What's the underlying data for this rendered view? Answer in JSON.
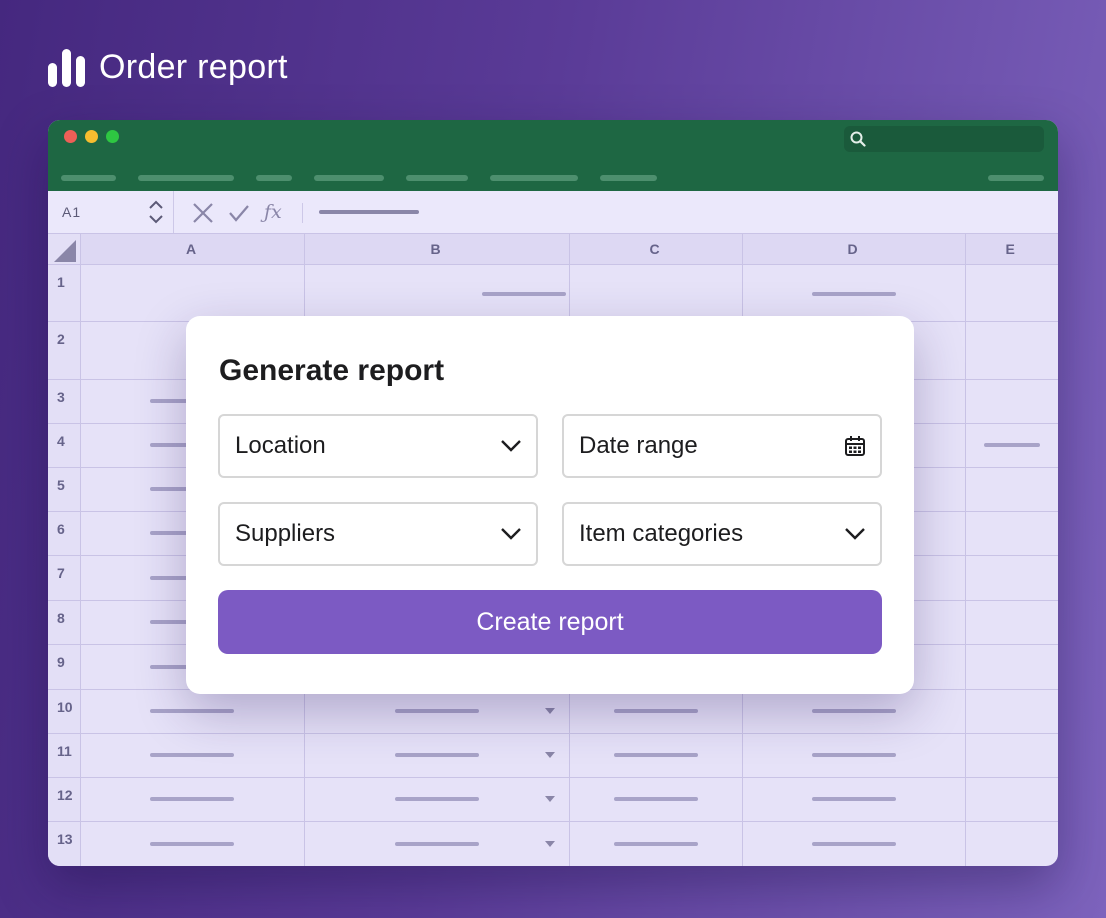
{
  "header": {
    "title": "Order report",
    "icon": "bar-chart-icon"
  },
  "spreadsheet": {
    "cell_reference": "A1",
    "columns": [
      "A",
      "B",
      "C",
      "D",
      "E"
    ],
    "rows": [
      "1",
      "2",
      "3",
      "4",
      "5",
      "6",
      "7",
      "8",
      "9",
      "10",
      "11",
      "12",
      "13"
    ],
    "accent_color": "#1e6743"
  },
  "dialog": {
    "title": "Generate report",
    "fields": [
      {
        "label": "Location",
        "icon": "chevron-down-icon"
      },
      {
        "label": "Date range",
        "icon": "calendar-icon"
      },
      {
        "label": "Suppliers",
        "icon": "chevron-down-icon"
      },
      {
        "label": "Item categories",
        "icon": "chevron-down-icon"
      }
    ],
    "submit_label": "Create report",
    "submit_color": "#7c5ac3"
  }
}
